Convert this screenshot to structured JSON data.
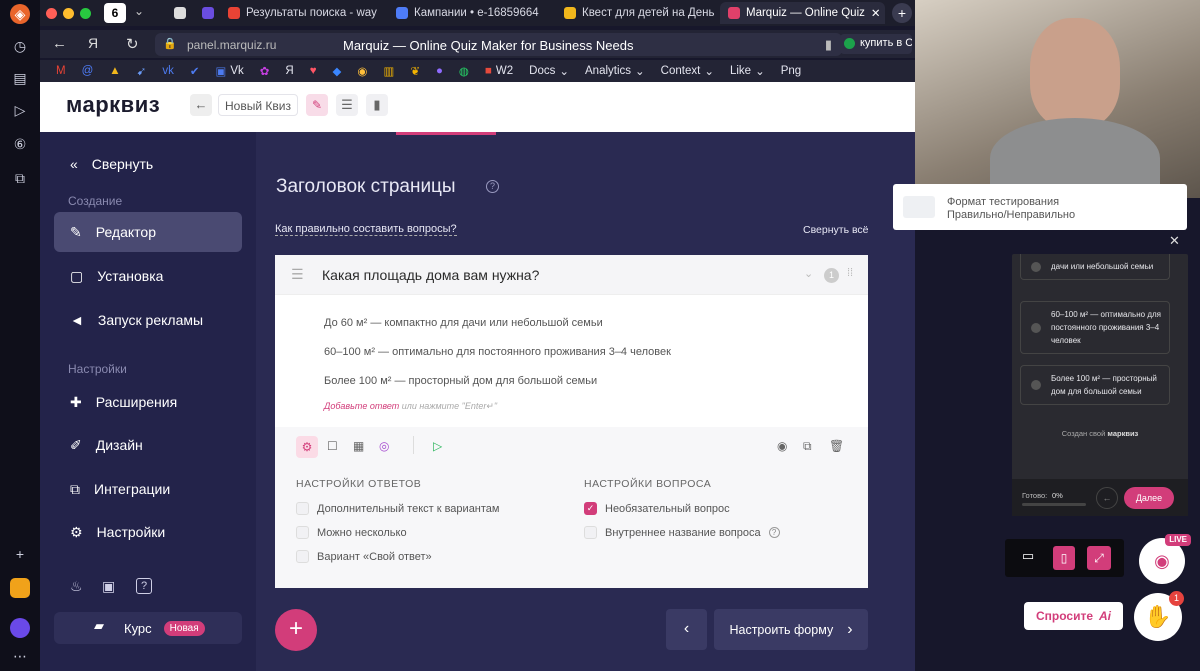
{
  "browser": {
    "tabs": [
      {
        "label": "Результаты поиска - way",
        "color": "#e94335"
      },
      {
        "label": "Кампании • е-16859664",
        "color": "#4e7cf7"
      },
      {
        "label": "Квест для детей на День",
        "color": "#f1b71c"
      },
      {
        "label": "Marquiz — Online Quiz",
        "color": "#e0406a"
      }
    ],
    "url": "panel.marquiz.ru",
    "page_title": "Marquiz — Online Quiz Maker for Business Needs",
    "right_tab": "купить в С",
    "bookmarks": [
      "Vk",
      "W2",
      "Docs",
      "Analytics",
      "Context",
      "Like",
      "Png"
    ]
  },
  "app": {
    "logo": "марквиз",
    "quiz_name": "Новый Квиз"
  },
  "sidebar": {
    "collapse": "Свернуть",
    "section_create": "Создание",
    "section_settings": "Настройки",
    "items": [
      {
        "label": "Редактор",
        "icon": "pencil-icon"
      },
      {
        "label": "Установка",
        "icon": "install-icon"
      },
      {
        "label": "Запуск рекламы",
        "icon": "megaphone-icon"
      },
      {
        "label": "Расширения",
        "icon": "puzzle-icon"
      },
      {
        "label": "Дизайн",
        "icon": "brush-icon"
      },
      {
        "label": "Интеграции",
        "icon": "integrations-icon"
      },
      {
        "label": "Настройки",
        "icon": "gear-icon"
      }
    ],
    "course_label": "Курс",
    "course_badge": "Новая"
  },
  "editor": {
    "page_heading": "Заголовок страницы",
    "help_link": "Как правильно составить вопросы?",
    "collapse_all": "Свернуть всё",
    "question": {
      "title": "Какая площадь дома вам нужна?",
      "number": "1",
      "answers": [
        "До 60 м² — компактно для дачи или небольшой семьи",
        "60–100 м² — оптимально для постоянного проживания 3–4 человек",
        "Более 100 м² — просторный дом для большой семьи"
      ],
      "add_answer": "Добавьте ответ",
      "add_answer_hint": "или нажмите \"Enter↵\""
    },
    "answer_settings_title": "НАСТРОЙКИ ОТВЕТОВ",
    "answer_settings": [
      "Дополнительный текст к вариантам",
      "Можно несколько",
      "Вариант «Свой ответ»"
    ],
    "question_settings_title": "НАСТРОЙКИ ВОПРОСА",
    "question_settings": [
      {
        "label": "Необязательный вопрос",
        "checked": true
      },
      {
        "label": "Внутреннее название вопроса",
        "checked": false
      }
    ],
    "next_button": "Настроить форму"
  },
  "preview": {
    "format_line1": "Формат тестирования",
    "format_line2": "Правильно/Неправильно",
    "answers": [
      "дачи или небольшой семьи",
      "60–100 м² — оптимально для постоянного проживания 3–4 человек",
      "Более 100 м² — простор­ный дом для большой семьи"
    ],
    "made_with": "Создан свой",
    "made_with_brand": "марквиз",
    "progress_label": "Готово:",
    "progress_value": "0%",
    "next": "Далее",
    "live_badge": "LIVE",
    "ask_button": "Спросите",
    "notification_count": "1"
  },
  "colors": {
    "accent": "#d23d7a",
    "sidebar": "#23234a",
    "main": "#2a2a52"
  }
}
